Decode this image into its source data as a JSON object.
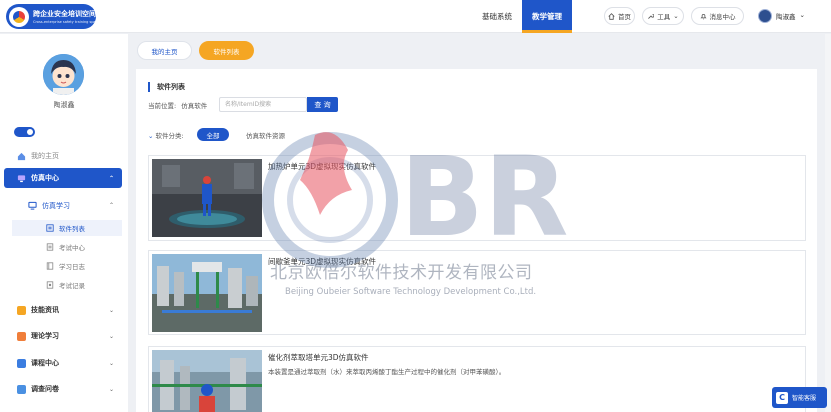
{
  "header": {
    "logo_title": "跨企业安全培训空间",
    "logo_subtitle": "Cross-enterprise safety training space",
    "nav": [
      {
        "label": "基础系统"
      },
      {
        "label": "教学管理"
      }
    ],
    "home_label": "首页",
    "tools_label": "工具",
    "messages_label": "消息中心",
    "user_name": "陶淑鑫"
  },
  "sidebar": {
    "user_name": "陶淑鑫",
    "items": {
      "my_home": "我的主页",
      "sim_center": "仿真中心",
      "sim_learning": "仿真学习",
      "software_list": "软件列表",
      "exam_center": "考试中心",
      "study_log": "学习日志",
      "exam_records": "考试记录",
      "skill_info": "技能资讯",
      "theory": "理论学习",
      "course_center": "课程中心",
      "survey": "调查问卷"
    }
  },
  "tabs": {
    "home": "我的主页",
    "software": "软件列表"
  },
  "main": {
    "title": "软件列表",
    "crumb_label": "当前位置:",
    "crumb_value": "仿真软件",
    "search_placeholder": "名称/ItemID搜索",
    "search_button": "查 询",
    "category_label": "软件分类:",
    "category_all": "全部",
    "category_resource": "仿真软件资源",
    "cards": [
      {
        "title": "加热炉单元3D虚拟现实仿真软件",
        "desc": ""
      },
      {
        "title": "间歇釜单元3D虚拟现实仿真软件",
        "desc": ""
      },
      {
        "title": "催化剂萃取塔单元3D仿真软件",
        "desc": "本装置是通过萃取剂（水）来萃取丙烯酸丁酯生产过程中的催化剂（对甲苯磺酸）。"
      }
    ]
  },
  "watermark": {
    "brand": "BR",
    "company_cn": "北京欧倍尔软件技术开发有限公司",
    "company_en": "Beijing Oubeier Software Technology Development Co.,Ltd."
  },
  "service": {
    "label": "智能客服"
  },
  "colors": {
    "primary": "#1f56c9",
    "accent": "#f5a623",
    "background": "#eef0f4"
  }
}
